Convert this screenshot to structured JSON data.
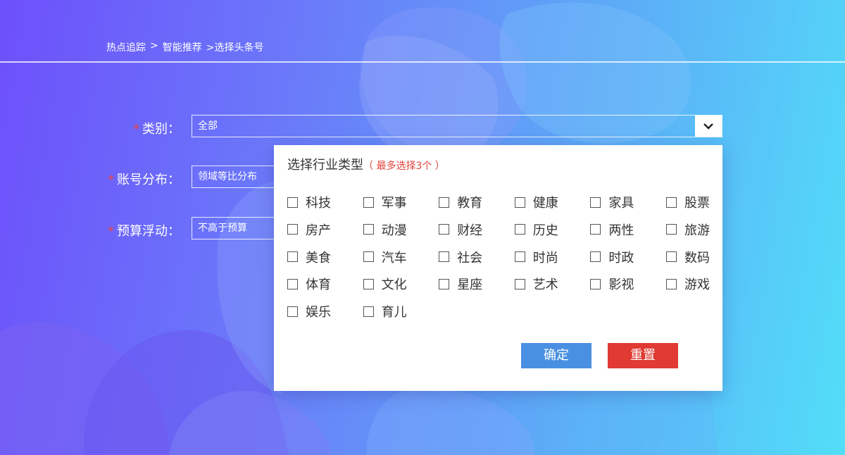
{
  "breadcrumb": {
    "item1": "热点追踪",
    "sep1": ">",
    "item2": "智能推荐",
    "item3": ">选择头条号"
  },
  "form": {
    "required_mark": "*",
    "category": {
      "label": "类别：",
      "value": "全部"
    },
    "distribution": {
      "label": "账号分布：",
      "value": "领域等比分布"
    },
    "budget": {
      "label": "预算浮动：",
      "value": "不高于预算"
    }
  },
  "dropdown": {
    "title": "选择行业类型",
    "hint": "（ 最多选择3个 ）",
    "options": [
      "科技",
      "军事",
      "教育",
      "健康",
      "家具",
      "股票",
      "房产",
      "动漫",
      "财经",
      "历史",
      "两性",
      "旅游",
      "美食",
      "汽车",
      "社会",
      "时尚",
      "时政",
      "数码",
      "体育",
      "文化",
      "星座",
      "艺术",
      "影视",
      "游戏",
      "娱乐",
      "育儿"
    ],
    "confirm_label": "确定",
    "reset_label": "重置"
  },
  "icons": {
    "select_arrow": "chevron-down-icon"
  },
  "colors": {
    "confirm": "#4a90e2",
    "reset": "#e03a33",
    "required": "#e5424a"
  }
}
